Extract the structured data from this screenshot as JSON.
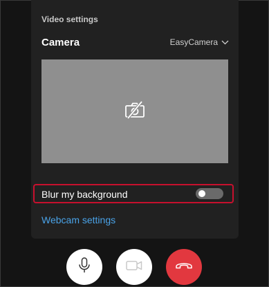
{
  "video_settings": {
    "section_title": "Video settings",
    "camera_label": "Camera",
    "camera_selected": "EasyCamera",
    "preview_icon": "camera-off-icon",
    "blur_label": "Blur my background",
    "blur_enabled": false,
    "webcam_settings_link": "Webcam settings"
  },
  "call_controls": {
    "mic_icon": "microphone-icon",
    "video_icon": "video-camera-icon",
    "hangup_icon": "hang-up-icon"
  },
  "colors": {
    "background": "#141414",
    "panel": "#212121",
    "link": "#4aa3e8",
    "highlight_border": "#c8102e",
    "hangup": "#e2383f"
  }
}
